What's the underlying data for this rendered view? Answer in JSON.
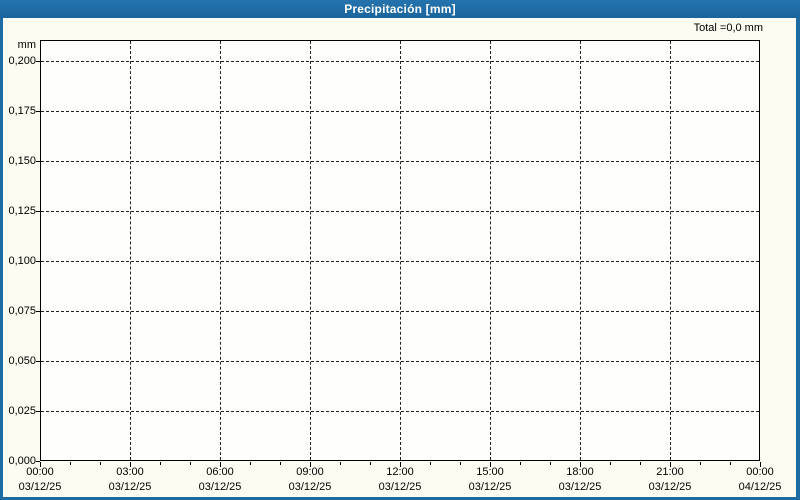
{
  "window": {
    "title": "Precipitación [mm]"
  },
  "header": {
    "total_label": "Total =0,0 mm"
  },
  "colors": {
    "titlebar_blue": "#1E6CA4",
    "frame_blue": "#1E6CA4",
    "background": "#FCFCF2",
    "plot_background": "#FEFEFC",
    "grid": "#222222",
    "text": "#000000",
    "title_text": "#FFFFFF"
  },
  "y_axis": {
    "unit": "mm",
    "tick_labels": [
      "0,200",
      "0,175",
      "0,150",
      "0,125",
      "0,100",
      "0,075",
      "0,050",
      "0,025",
      "0,000"
    ]
  },
  "x_axis": {
    "ticks": [
      {
        "time": "00:00",
        "date": "03/12/25"
      },
      {
        "time": "03:00",
        "date": "03/12/25"
      },
      {
        "time": "06:00",
        "date": "03/12/25"
      },
      {
        "time": "09:00",
        "date": "03/12/25"
      },
      {
        "time": "12:00",
        "date": "03/12/25"
      },
      {
        "time": "15:00",
        "date": "03/12/25"
      },
      {
        "time": "18:00",
        "date": "03/12/25"
      },
      {
        "time": "21:00",
        "date": "03/12/25"
      },
      {
        "time": "00:00",
        "date": "04/12/25"
      }
    ],
    "minor_tick_interval_hours": 1,
    "major_tick_interval_hours": 3
  },
  "chart_data": {
    "type": "bar",
    "title": "Precipitación [mm]",
    "ylabel": "mm",
    "ylim": [
      0,
      0.21
    ],
    "y_tick_step": 0.025,
    "y_ticks": [
      0.0,
      0.025,
      0.05,
      0.075,
      0.1,
      0.125,
      0.15,
      0.175,
      0.2
    ],
    "x": [
      "03/12/25 00:00",
      "03/12/25 03:00",
      "03/12/25 06:00",
      "03/12/25 09:00",
      "03/12/25 12:00",
      "03/12/25 15:00",
      "03/12/25 18:00",
      "03/12/25 21:00",
      "04/12/25 00:00"
    ],
    "values": [
      0,
      0,
      0,
      0,
      0,
      0,
      0,
      0,
      0
    ],
    "total_mm": 0.0,
    "total_label": "Total =0,0 mm",
    "grid": true,
    "legend_position": "none"
  }
}
